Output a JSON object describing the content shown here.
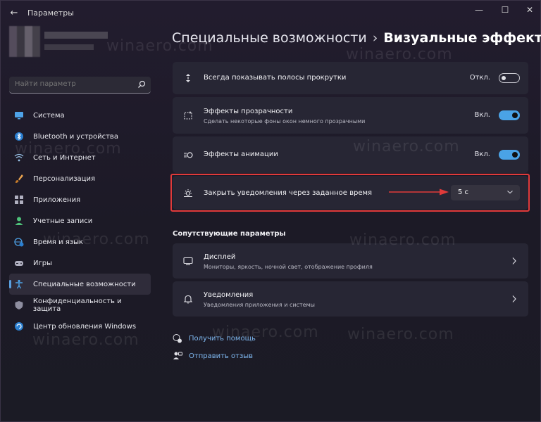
{
  "window": {
    "app_title": "Параметры",
    "controls": {
      "minimize": "—",
      "maximize": "☐",
      "close": "✕"
    }
  },
  "search": {
    "placeholder": "Найти параметр"
  },
  "sidebar": {
    "items": [
      {
        "label": "Система",
        "icon": "monitor-icon",
        "color": "#4ea3e8"
      },
      {
        "label": "Bluetooth и устройства",
        "icon": "bluetooth-icon",
        "color": "#4ea3e8"
      },
      {
        "label": "Сеть и Интернет",
        "icon": "wifi-icon",
        "color": "#9ac3e8"
      },
      {
        "label": "Персонализация",
        "icon": "brush-icon",
        "color": "#e8a24e"
      },
      {
        "label": "Приложения",
        "icon": "apps-icon",
        "color": "#b0b0c0"
      },
      {
        "label": "Учетные записи",
        "icon": "person-icon",
        "color": "#4ec27a"
      },
      {
        "label": "Время и язык",
        "icon": "globe-clock-icon",
        "color": "#4ea3e8"
      },
      {
        "label": "Игры",
        "icon": "gamepad-icon",
        "color": "#b0b0c0"
      },
      {
        "label": "Специальные возможности",
        "icon": "accessibility-icon",
        "color": "#4ea3e8",
        "active": true
      },
      {
        "label": "Конфиденциальность и защита",
        "icon": "shield-icon",
        "color": "#b0b0c0"
      },
      {
        "label": "Центр обновления Windows",
        "icon": "update-icon",
        "color": "#4ea3e8"
      }
    ]
  },
  "breadcrumb": {
    "parent": "Специальные возможности",
    "separator": "›",
    "current": "Визуальные эффекты"
  },
  "settings": {
    "scrollbars": {
      "title": "Всегда показывать полосы прокрутки",
      "state": "Откл.",
      "on": false
    },
    "transparency": {
      "title": "Эффекты прозрачности",
      "subtitle": "Сделать некоторые фоны окон немного прозрачными",
      "state": "Вкл.",
      "on": true
    },
    "animation": {
      "title": "Эффекты анимации",
      "state": "Вкл.",
      "on": true
    },
    "notifications_timeout": {
      "title": "Закрыть уведомления через заданное время",
      "value": "5 с"
    }
  },
  "related": {
    "title": "Сопутствующие параметры",
    "display": {
      "title": "Дисплей",
      "subtitle": "Мониторы, яркость, ночной свет, отображение профиля"
    },
    "notifications": {
      "title": "Уведомления",
      "subtitle": "Уведомления приложения и системы"
    }
  },
  "links": {
    "help": "Получить помощь",
    "feedback": "Отправить отзыв"
  },
  "watermark": "winaero.com",
  "colors": {
    "accent": "#4aa3e6",
    "highlight": "#e03a3a",
    "link": "#7fb8f0"
  }
}
